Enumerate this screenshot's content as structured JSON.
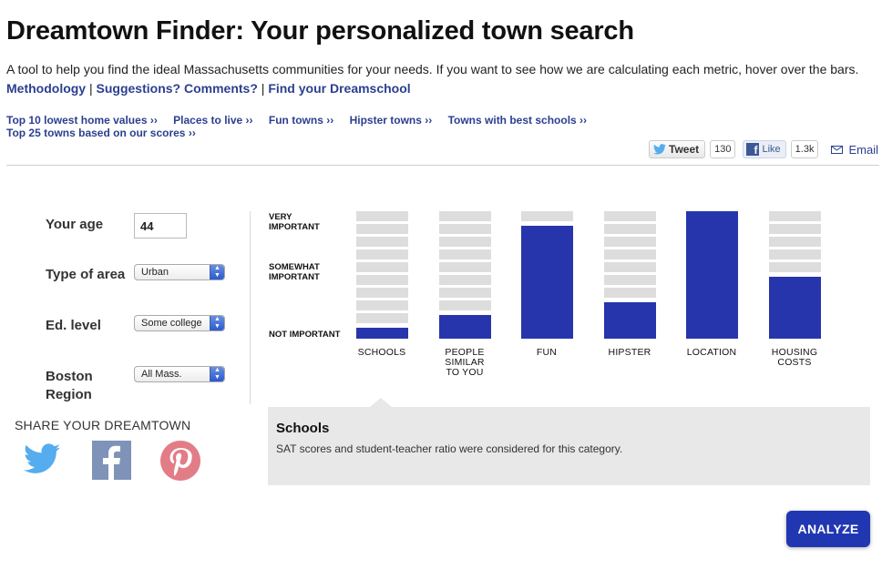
{
  "page": {
    "title": "Dreamtown Finder: Your personalized town search",
    "intro_text": "A tool to help you find the ideal Massachusetts communities for your needs. If you want to see how we are calculating each metric, hover over the bars.",
    "intro_links": [
      {
        "label": "Methodology"
      },
      {
        "label": "Suggestions? Comments?"
      },
      {
        "label": "Find your Dreamschool"
      }
    ],
    "separator": "|"
  },
  "quick_links": [
    {
      "label": "Top 10 lowest home values ››"
    },
    {
      "label": "Places to live ››"
    },
    {
      "label": "Fun towns ››"
    },
    {
      "label": "Hipster towns ››"
    },
    {
      "label": "Towns with best schools ››"
    },
    {
      "label": "Top 25 towns based on our scores ››"
    }
  ],
  "social": {
    "tweet_label": "Tweet",
    "tweet_count": "130",
    "like_label": "Like",
    "like_count": "1.3k",
    "email_label": "Email",
    "twitter_color": "#55acee",
    "facebook_color": "#3b5998"
  },
  "form": {
    "age": {
      "label": "Your age",
      "value": "44"
    },
    "area": {
      "label": "Type of area",
      "value": "Urban"
    },
    "education": {
      "label": "Ed. level",
      "value": "Some college"
    },
    "region": {
      "label": "Boston Region",
      "value": "All Mass."
    }
  },
  "share": {
    "title": "SHARE YOUR DREAMTOWN",
    "icons": [
      "twitter-icon",
      "facebook-icon",
      "pinterest-icon"
    ]
  },
  "importance_scale": {
    "very": "VERY IMPORTANT",
    "somewhat": "SOMEWHAT IMPORTANT",
    "not": "NOT IMPORTANT"
  },
  "bars": [
    {
      "label": "SCHOOLS",
      "level": 0.1
    },
    {
      "label": "PEOPLE SIMILAR TO YOU",
      "level": 0.2
    },
    {
      "label": "FUN",
      "level": 0.9
    },
    {
      "label": "HIPSTER",
      "level": 0.3
    },
    {
      "label": "LOCATION",
      "level": 1.0
    },
    {
      "label": "HOUSING COSTS",
      "level": 0.5
    }
  ],
  "info": {
    "title": "Schools",
    "text": "SAT scores and student-teacher ratio were considered for this category."
  },
  "analyze_label": "ANALYZE",
  "colors": {
    "bar_fill": "#2735ad",
    "link": "#2b3f8f",
    "analyze": "#2137b2"
  }
}
